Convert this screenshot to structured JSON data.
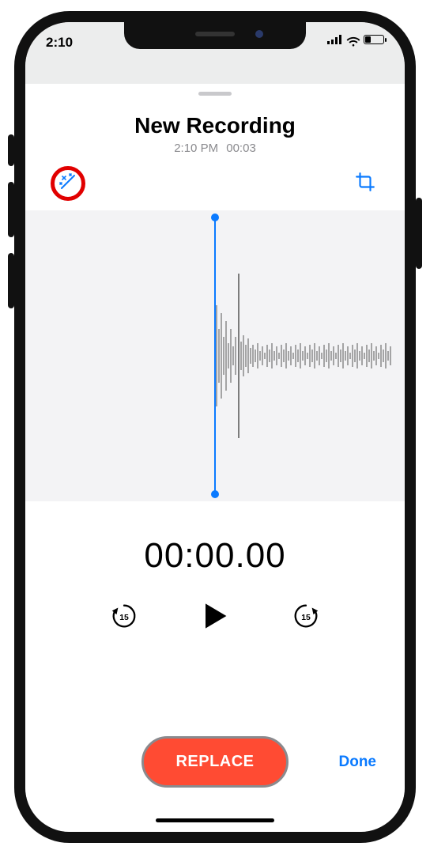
{
  "status": {
    "time": "2:10"
  },
  "recording": {
    "title": "New Recording",
    "timestamp": "2:10 PM",
    "duration": "00:03"
  },
  "playback": {
    "timer": "00:00.00",
    "skip_seconds": "15"
  },
  "actions": {
    "replace_label": "REPLACE",
    "done_label": "Done"
  },
  "colors": {
    "accent_blue": "#0a7aff",
    "replace_red": "#ff4b33",
    "highlight_ring": "#e10000"
  }
}
